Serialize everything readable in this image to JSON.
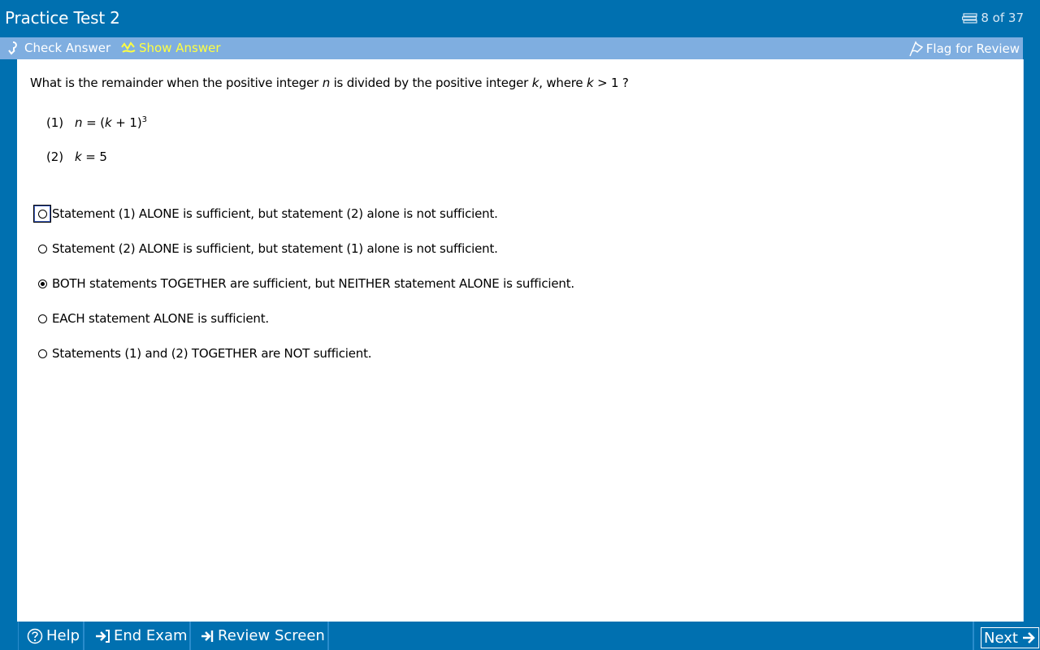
{
  "window": {
    "title": "Practice Test 2",
    "counter": "8 of 37"
  },
  "toolbar": {
    "check_answer": "Check Answer",
    "show_answer": "Show Answer",
    "flag_for_review": "Flag for Review"
  },
  "question": {
    "text_prefix": "What is the remainder when the positive integer ",
    "var_n": "n",
    "text_mid": " is divided by the positive integer ",
    "var_k": "k",
    "text_mid2": ", where ",
    "var_k2": "k",
    "text_suffix": " > 1 ?",
    "statements": [
      {
        "num": "(1)",
        "var": "n",
        "expr_a": " = (",
        "var2": "k",
        "expr_b": " + 1)",
        "sup": "3"
      },
      {
        "num": "(2)",
        "var": "k",
        "expr_a": " = 5"
      }
    ]
  },
  "options": [
    {
      "label": "Statement (1) ALONE is sufficient, but statement (2) alone is not sufficient.",
      "selected": false,
      "focused": true
    },
    {
      "label": "Statement (2) ALONE is sufficient, but statement (1) alone is not sufficient.",
      "selected": false,
      "focused": false
    },
    {
      "label": "BOTH statements TOGETHER are sufficient, but NEITHER statement ALONE is sufficient.",
      "selected": true,
      "focused": false
    },
    {
      "label": "EACH statement ALONE is sufficient.",
      "selected": false,
      "focused": false
    },
    {
      "label": "Statements (1) and (2) TOGETHER are NOT sufficient.",
      "selected": false,
      "focused": false
    }
  ],
  "bottom": {
    "help": "Help",
    "end_exam": "End Exam",
    "review_screen": "Review Screen",
    "next": "Next"
  },
  "colors": {
    "frame": "#0070b0",
    "toolbar": "#7faee0",
    "show_answer": "#ffff40"
  }
}
